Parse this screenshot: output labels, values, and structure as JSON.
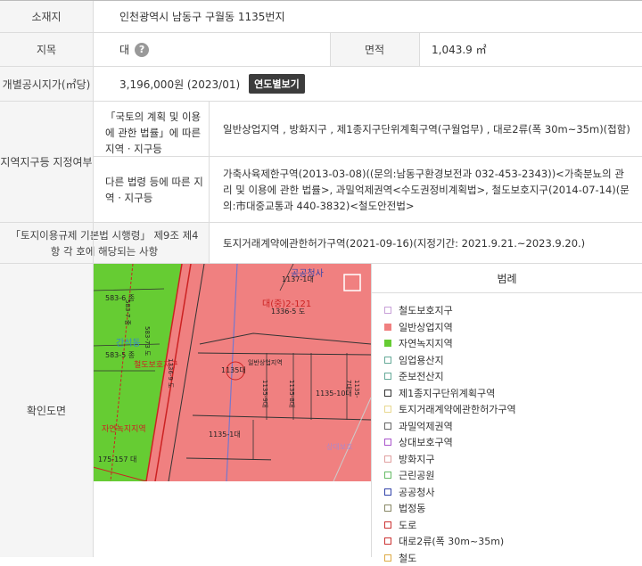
{
  "rows": {
    "location": {
      "label": "소재지",
      "value": "인천광역시 남동구 구월동 1135번지"
    },
    "land_category": {
      "label": "지목",
      "value": "대",
      "help": "?"
    },
    "area": {
      "label": "면적",
      "value": "1,043.9 ㎡"
    },
    "price": {
      "label": "개별공시지가(㎡당)",
      "value": "3,196,000원 (2023/01)",
      "button": "연도별보기"
    },
    "zoning": {
      "label": "지역지구등 지정여부",
      "sub1_label": "「국토의 계획 및 이용에 관한 법률」에 따른 지역 · 지구등",
      "sub1_value": "일반상업지역 , 방화지구 , 제1종지구단위계획구역(구월업무) , 대로2류(폭 30m~35m)(접함)",
      "sub2_label": "다른 법령 등에 따른 지역 · 지구등",
      "sub2_value": "가축사육제한구역(2013-03-08)((문의:남동구환경보전과 032-453-2343))<가축분뇨의 관리 및 이용에 관한 법률>, 과밀억제권역<수도권정비계획법>, 철도보호지구(2014-07-14)(문의:市대중교통과 440-3832)<철도안전법>"
    },
    "act": {
      "label": "「토지이용규제 기본법 시행령」 제9조 제4항 각 호에 해당되는 사항",
      "value": "토지거래계약에관한허가구역(2021-09-16)(지정기간: 2021.9.21.~2023.9.20.)"
    },
    "map": {
      "label": "확인도면"
    }
  },
  "map_labels": {
    "public_office": "공공청사",
    "lot_1137": "1137-1대",
    "lot_main": "대(중)2-121",
    "lot_1336": "1336-5 도",
    "lot_583_6": "583-6 종",
    "lot_583_5": "583-5 종",
    "green": "간석동",
    "rail_protect": "철도보호지구",
    "lot_1135": "1135대",
    "general_comm": "일반상업지역",
    "lot_1135_10": "1135-10대",
    "lot_1135_1": "1135-1대",
    "lot_1135_9": "1135-9대",
    "lot_1135_8": "1135-8대",
    "lot_1135_7": "1135-7대",
    "nature_green": "자연녹지지역",
    "lot_175": "175-157 대",
    "lot_1336_9": "1336-9 도",
    "lot_583_7": "583-7 종",
    "lot_583_73": "583-73 도",
    "road": "상대보호"
  },
  "legend": {
    "title": "범례",
    "items": [
      {
        "label": "철도보호지구",
        "color": "#c8a0d8",
        "fill": "#ffffff"
      },
      {
        "label": "일반상업지역",
        "color": "#f08080",
        "fill": "#f08080"
      },
      {
        "label": "자연녹지지역",
        "color": "#66cc33",
        "fill": "#66cc33"
      },
      {
        "label": "임업용산지",
        "color": "#66aa99",
        "fill": "#ffffff"
      },
      {
        "label": "준보전산지",
        "color": "#66aa99",
        "fill": "#ffffff"
      },
      {
        "label": "제1종지구단위계획구역",
        "color": "#333333",
        "fill": "#ffffff"
      },
      {
        "label": "토지거래계약에관한허가구역",
        "color": "#e8d890",
        "fill": "#ffffff"
      },
      {
        "label": "과밀억제권역",
        "color": "#666666",
        "fill": "#ffffff"
      },
      {
        "label": "상대보호구역",
        "color": "#aa55cc",
        "fill": "#ffffff"
      },
      {
        "label": "방화지구",
        "color": "#e0a0a0",
        "fill": "#ffffff"
      },
      {
        "label": "근린공원",
        "color": "#66bb66",
        "fill": "#ffffff"
      },
      {
        "label": "공공청사",
        "color": "#3344aa",
        "fill": "#ffffff"
      },
      {
        "label": "법정동",
        "color": "#888866",
        "fill": "#ffffff"
      },
      {
        "label": "도로",
        "color": "#cc3333",
        "fill": "#ffffff"
      },
      {
        "label": "대로2류(폭 30m~35m)",
        "color": "#cc3333",
        "fill": "#ffffff"
      },
      {
        "label": "철도",
        "color": "#ddaa44",
        "fill": "#ffffff"
      }
    ]
  }
}
